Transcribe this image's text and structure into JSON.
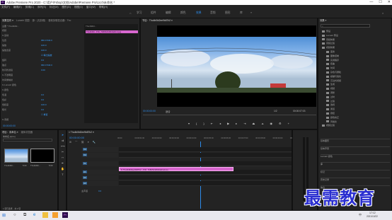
{
  "titlebar": {
    "logo": "Pr",
    "title": "Adobe Premiere Pro 2020 - C:\\用户\\Fshop\\文档\\Adobe\\Premiere Pro\\14.0\\未命名 *",
    "min": "—",
    "max": "☐",
    "close": "✕"
  },
  "menu": [
    "文件(F)",
    "编辑(E)",
    "剪辑(C)",
    "序列(S)",
    "标记(M)",
    "图形(G)",
    "视图(V)",
    "窗口(W)",
    "帮助(H)"
  ],
  "workspaces": {
    "items": [
      "学习",
      "组件",
      "编辑",
      "颜色",
      "效果",
      "音频",
      "图形",
      "库"
    ],
    "active_index": 4,
    "more": "»"
  },
  "effect_controls": {
    "tabs": [
      "效果控件 ≡",
      "Lumetri 范围",
      "源：(无剪辑)",
      "音频剪辑混合器：Tho"
    ],
    "clip_path": "主要 * Tho4b0bl…",
    "clip_name": "Tho4b0bl…",
    "rows": [
      {
        "label": "视频",
        "value": ""
      },
      {
        "label": "fx 运动",
        "value": ""
      },
      {
        "label": "位置",
        "value": "960.0  540.0"
      },
      {
        "label": "缩放",
        "value": "100.0"
      },
      {
        "label": "缩放宽度",
        "value": "100.0"
      },
      {
        "label": "",
        "value": "☑ 等比缩放"
      },
      {
        "label": "旋转",
        "value": "0.0"
      },
      {
        "label": "锚点",
        "value": "960.0  540.0"
      },
      {
        "label": "防闪烁滤镜",
        "value": "0.00"
      },
      {
        "label": "fx 不透明度",
        "value": ""
      },
      {
        "label": "时间重映射",
        "value": ""
      },
      {
        "label": "fx Lumetri 颜色",
        "value": ""
      },
      {
        "label": "fx 颜色",
        "value": ""
      },
      {
        "label": "色温",
        "value": "0.0"
      },
      {
        "label": "色彩",
        "value": "0.0"
      },
      {
        "label": "饱和度",
        "value": "100.0"
      },
      {
        "label": "曝光",
        "value": "0.0"
      },
      {
        "label": "",
        "value": "☐ 重置"
      },
      {
        "label": "fx 音频",
        "value": ""
      }
    ],
    "timecode": "00:00:00:00",
    "mini_clip": "Tho4b0bl...PrD_7b8b52446b0a9rnd.jpg"
  },
  "program": {
    "tab": "节目：Tho4b0bl2ee9b87b2 ≡",
    "timecode_left": "00:00:00:00",
    "fit": "适合",
    "quality": "1/2",
    "timecode_right": "00:00:07:03"
  },
  "effects_panel": {
    "tab": "效果 ≡",
    "search_placeholder": "",
    "tree": [
      {
        "label": "预设",
        "depth": 0,
        "kind": "folder"
      },
      {
        "label": "Lumetri 预设",
        "depth": 0,
        "kind": "folder"
      },
      {
        "label": "音频效果",
        "depth": 0,
        "kind": "folder"
      },
      {
        "label": "音频过渡",
        "depth": 0,
        "kind": "folder"
      },
      {
        "label": "视频效果",
        "depth": 0,
        "kind": "folder"
      },
      {
        "label": "变换",
        "depth": 1,
        "kind": "folder"
      },
      {
        "label": "图像控制",
        "depth": 1,
        "kind": "folder"
      },
      {
        "label": "实用程序",
        "depth": 1,
        "kind": "folder"
      },
      {
        "label": "扭曲",
        "depth": 1,
        "kind": "folder"
      },
      {
        "label": "时间",
        "depth": 1,
        "kind": "folder"
      },
      {
        "label": "杂色与颗粒",
        "depth": 1,
        "kind": "folder"
      },
      {
        "label": "模糊与锐化",
        "depth": 1,
        "kind": "folder"
      },
      {
        "label": "沉浸式视频",
        "depth": 1,
        "kind": "folder"
      },
      {
        "label": "生成",
        "depth": 1,
        "kind": "folder"
      },
      {
        "label": "视频",
        "depth": 1,
        "kind": "folder"
      },
      {
        "label": "调整",
        "depth": 1,
        "kind": "folder"
      },
      {
        "label": "过时",
        "depth": 1,
        "kind": "folder"
      },
      {
        "label": "过渡",
        "depth": 1,
        "kind": "folder"
      },
      {
        "label": "透视",
        "depth": 1,
        "kind": "folder"
      },
      {
        "label": "通道",
        "depth": 1,
        "kind": "folder"
      },
      {
        "label": "键控",
        "depth": 1,
        "kind": "folder"
      },
      {
        "label": "颜色校正",
        "depth": 1,
        "kind": "folder"
      },
      {
        "label": "风格化",
        "depth": 1,
        "kind": "folder"
      },
      {
        "label": "视频过渡",
        "depth": 0,
        "kind": "folder"
      }
    ],
    "subitems": [
      "ASC CDL",
      "Lumetri 颜色",
      "亮度曲线",
      "亮度校正器",
      "广播颜色",
      "快速颜色校正器",
      "更改颜色",
      "颜色"
    ],
    "subitems_selected": 7,
    "bottom_tabs": [
      "基本图形",
      "基本声音",
      "Lumetri 颜色",
      "库",
      "标记",
      "历史记录",
      "信息"
    ]
  },
  "project_panel": {
    "tabs": [
      "项目：未命名 ≡",
      "媒体浏览器"
    ],
    "file": "未命名.prproj",
    "item_count": "1 项已选择，共 2 项",
    "items": [
      {
        "name": "Tho4b0bl…",
        "duration": "5:00"
      },
      {
        "name": "Tho4b0bl…",
        "duration": "5:00"
      }
    ]
  },
  "timeline": {
    "tab": "× Tho4b0bl2ee9b87b2 ≡",
    "timecode": "00:00:00:00",
    "ruler": [
      "00:00",
      "00:00:01:00",
      "00:00:02:00",
      "00:00:03:00",
      "00:00:04:00",
      "00:00:05:00",
      "00:00:06:00",
      "00:00:07:00",
      "00:00:08:00",
      "00:00:09:00",
      "00:00:10:00"
    ],
    "video_tracks": [
      "V3",
      "V2",
      "V1"
    ],
    "audio_tracks": [
      "A1",
      "A2",
      "A3"
    ],
    "master": "主声道",
    "master_value": "0.0",
    "clip_name": "fx Tho4b0bl2ee9b87b2…PrD_7b8b52446b0a9rnd.jpg"
  },
  "taskbar": {
    "time": "17:12",
    "date": "2021/10/22",
    "lang": "中",
    "icons": [
      "windows-start",
      "search",
      "task-view",
      "edge",
      "explorer",
      "store",
      "premiere"
    ]
  },
  "watermark": "最需教育",
  "colors": {
    "accent": "#2d8ceb",
    "clip_pink": "#d867cf",
    "panel": "#232323",
    "background": "#1d1d1d"
  }
}
